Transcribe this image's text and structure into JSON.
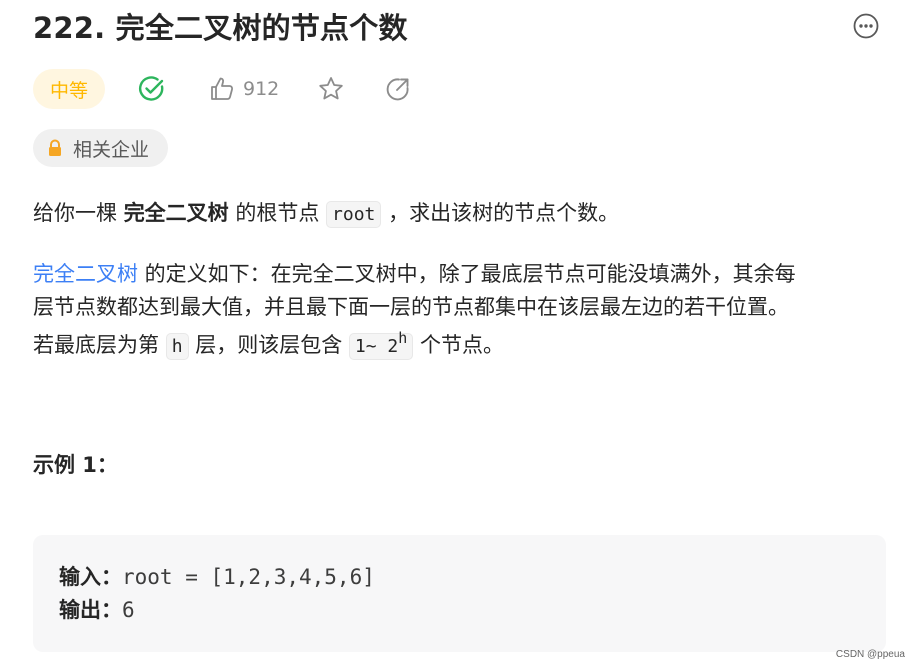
{
  "problem": {
    "title": "222. 完全二叉树的节点个数",
    "difficulty": "中等",
    "likes": "912",
    "company_label": "相关企业"
  },
  "description": {
    "p1_part1": "给你一棵 ",
    "p1_bold": "完全二叉树",
    "p1_part2": " 的根节点 ",
    "p1_code": "root",
    "p1_part3": " ，求出该树的节点个数。",
    "p2_link": "完全二叉树",
    "p2_line1_rest": " 的定义如下：在完全二叉树中，除了最底层节点可能没填满外，其余每",
    "p2_line2": "层节点数都达到最大值，并且最下面一层的节点都集中在该层最左边的若干位置。",
    "p2_line3_part1": "若最底层为第 ",
    "p2_code_h": "h",
    "p2_line3_part2": " 层，则该层包含 ",
    "p2_code_range_base": "1~ 2",
    "p2_code_range_sup": "h",
    "p2_line3_part3": " 个节点。"
  },
  "example": {
    "title": "示例 1：",
    "input_label": "输入：",
    "input_value": "root = [1,2,3,4,5,6]",
    "output_label": "输出：",
    "output_value": "6"
  },
  "watermark": "CSDN @ppeua",
  "colors": {
    "difficulty_text": "#ffb800",
    "difficulty_bg": "#fff6e0",
    "solved_green": "#2db55d",
    "link_blue": "#3c7ff5",
    "lock_orange": "#f5a623"
  },
  "icons": {
    "more": "more-horizontal-circle-icon",
    "solved": "check-circle-icon",
    "like": "thumbs-up-icon",
    "star": "star-icon",
    "share": "share-arrow-icon",
    "lock": "lock-icon"
  }
}
